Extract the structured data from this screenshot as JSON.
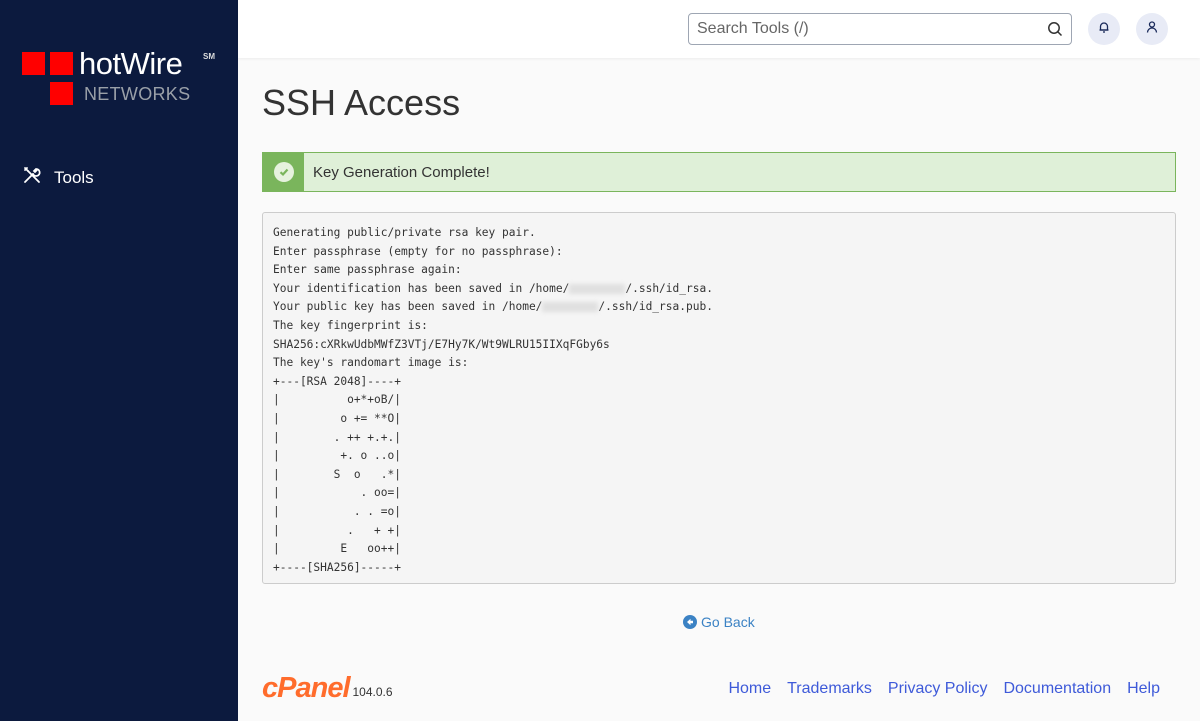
{
  "sidebar": {
    "logo": {
      "brand": "hotWire",
      "service_mark": "SM",
      "subtitle": "NETWORKS",
      "square_color": "#ff0000"
    },
    "items": [
      {
        "label": "Tools",
        "icon": "tools-icon"
      }
    ]
  },
  "topbar": {
    "search_placeholder": "Search Tools (/)",
    "search_value": "",
    "notifications_icon": "bell-icon",
    "user_icon": "user-icon"
  },
  "page": {
    "title": "SSH Access",
    "alert": {
      "type": "success",
      "text": "Key Generation Complete!",
      "color": "#7ab55c"
    },
    "output_lines": [
      "Generating public/private rsa key pair.",
      "Enter passphrase (empty for no passphrase):",
      "Enter same passphrase again:",
      "Your identification has been saved in /home/",
      "/.ssh/id_rsa.",
      "Your public key has been saved in /home/",
      "/.ssh/id_rsa.pub.",
      "The key fingerprint is:",
      "SHA256:cXRkwUdbMWfZ3VTj/E7Hy7K/Wt9WLRU15IIXqFGby6s",
      "The key's randomart image is:"
    ],
    "randomart": "+---[RSA 2048]----+\n|          o+*+oB/|\n|         o += **O|\n|        . ++ +.+.|\n|         +. o ..o|\n|        S  o   .*|\n|            . oo=|\n|           . . =o|\n|          .   + +|\n|         E   oo++|\n+----[SHA256]-----+",
    "go_back_label": "Go Back"
  },
  "footer": {
    "brand": "cPanel",
    "version": "104.0.6",
    "links": [
      "Home",
      "Trademarks",
      "Privacy Policy",
      "Documentation",
      "Help"
    ]
  }
}
